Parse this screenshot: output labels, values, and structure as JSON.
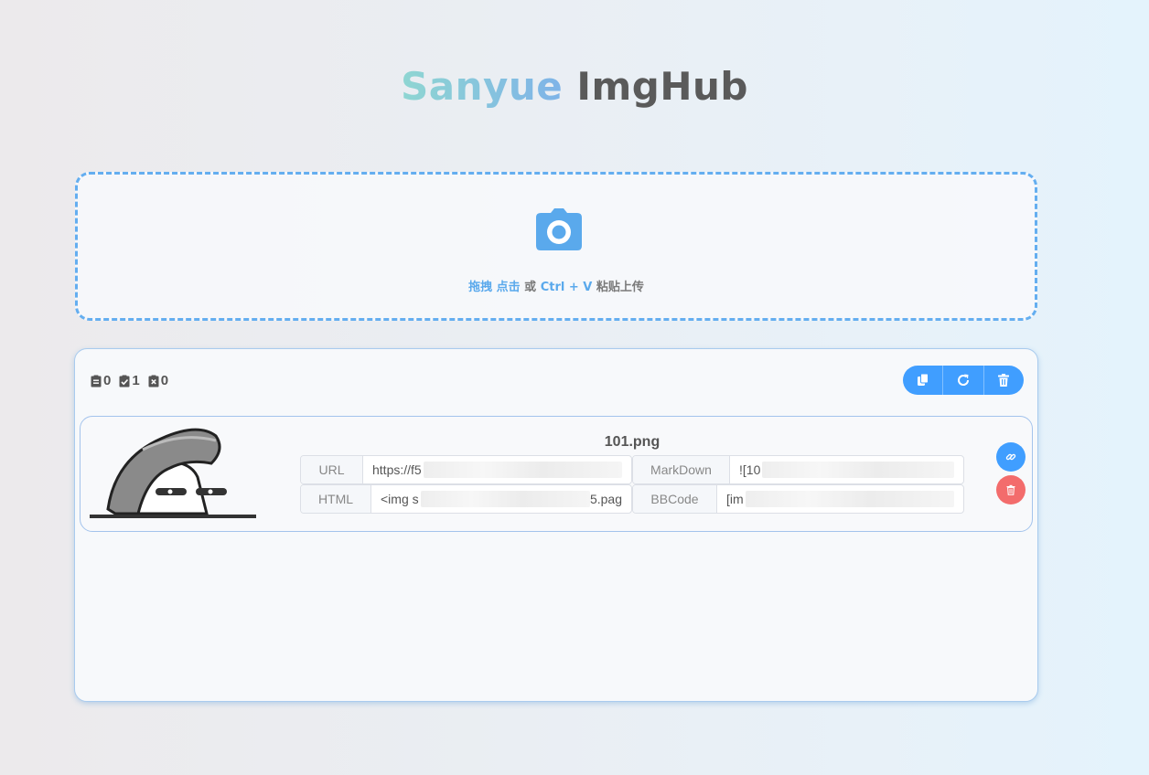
{
  "header": {
    "title_part1": "Sanyue",
    "title_part2": "ImgHub"
  },
  "upload": {
    "hint_drag": "拖拽",
    "hint_click": "点击",
    "hint_or": "或",
    "hint_keys": "Ctrl + V",
    "hint_paste": "粘贴上传",
    "icon": "camera-icon"
  },
  "stats": {
    "pending": "0",
    "success": "1",
    "failed": "0"
  },
  "toolbar": {
    "icons": [
      "copy-all-icon",
      "refresh-icon",
      "trash-icon"
    ]
  },
  "uploaded_item": {
    "filename": "101.png",
    "links": [
      {
        "label": "URL",
        "value_prefix": "https://f5",
        "value_suffix": ""
      },
      {
        "label": "MarkDown",
        "value_prefix": "![10",
        "value_suffix": ""
      },
      {
        "label": "HTML",
        "value_prefix": "<img s",
        "value_suffix": "5.pag"
      },
      {
        "label": "BBCode",
        "value_prefix": "[im",
        "value_suffix": ""
      }
    ],
    "actions": [
      "copy-link-icon",
      "delete-icon"
    ]
  },
  "colors": {
    "accent": "#409eff",
    "dashed_border": "#64aef0",
    "danger": "#f36c6c",
    "title_gradient_start": "#8fd6d2",
    "title_gradient_end": "#7eb3e8"
  }
}
